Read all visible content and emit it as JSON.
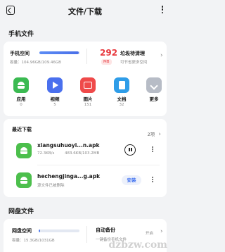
{
  "header": {
    "title": "文件/下载"
  },
  "local_section": {
    "title": "手机文件"
  },
  "storage": {
    "label": "手机空间",
    "capacity": "容量：104.96GB/109.46GB",
    "used_fraction": 0.96,
    "junk_value": "292",
    "junk_unit": "MB",
    "junk_label": "垃圾待清理",
    "junk_sub": "可节省更多空间"
  },
  "categories": [
    {
      "name": "应用",
      "count": "0",
      "icon": "android-icon",
      "color": "#3bba52"
    },
    {
      "name": "视频",
      "count": "5",
      "icon": "video-icon",
      "color": "#4a70ee"
    },
    {
      "name": "图片",
      "count": "151",
      "icon": "picture-icon",
      "color": "#ef4a4a"
    },
    {
      "name": "文档",
      "count": "32",
      "icon": "document-icon",
      "color": "#2f9de8"
    },
    {
      "name": "更多",
      "count": "",
      "icon": "more-icon",
      "color": "#b7bcc6"
    }
  ],
  "recent": {
    "title": "最近下载",
    "count": "2项",
    "items": [
      {
        "name": "xiangsuhuoyi...n.apk",
        "speed": "72.3KB/s",
        "progress": "483.6KB/103.2MB",
        "action": "pause"
      },
      {
        "name": "hechengjinga...g.apk",
        "status": "源文件已被删除",
        "action_label": "安装"
      }
    ]
  },
  "cloud_section": {
    "title": "网盘文件"
  },
  "cloud": {
    "label": "网盘空间",
    "capacity": "容量：15.3GB/1031GB",
    "used_fraction": 0.015,
    "backup_label": "自动备份",
    "backup_sub": "一键备份手机文件",
    "backup_status": "开启"
  },
  "watermark": "dzbzw.com"
}
